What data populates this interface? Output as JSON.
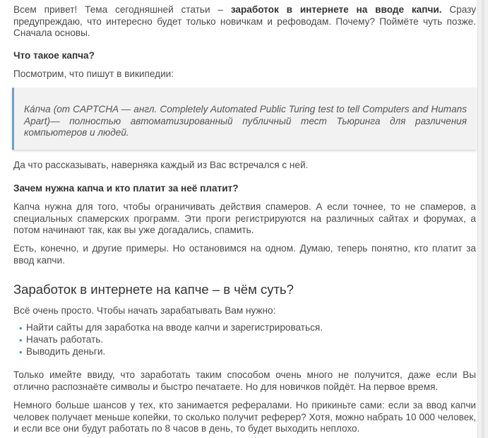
{
  "intro": {
    "text_a": "Всем привет! Тема сегодняшней статьи – ",
    "bold": "заработок в интернете на вводе капчи.",
    "text_b": " Сразу предупреждаю, что интересно будет только новичкам и рефоводам. Почему? Поймёте чуть позже. Сначала основы."
  },
  "section1": {
    "heading": "Что такое капча?",
    "lead": "Посмотрим, что пишут в википедии:",
    "quote": "Ка́пча (от CAPTCHA — англ. Completely Automated Public Turing test to tell Computers and Humans Apart)— полностью автоматизированный публичный тест Тьюринга для различения компьютеров и людей.",
    "after_quote": "Да что рассказывать, наверняка каждый из Вас встречался с ней."
  },
  "section2": {
    "heading": "Зачем нужна капча и кто платит за неё платит?",
    "p1": "Капча нужна для того, чтобы ограничивать действия спамеров. А если точнее, то не спамеров, а специальных спамерских программ. Эти проги регистрируются на различных сайтах и форумах, а потом начинают так, как вы уже догадались, спамить.",
    "p2": "Есть, конечно, и другие примеры. Но остановимся на одном. Думаю, теперь понятно, кто платит за ввод капчи."
  },
  "section3": {
    "heading": "Заработок в интернете на капче – в чём суть?",
    "lead": "Всё очень просто. Чтобы начать зарабатывать Вам нужно:",
    "items": [
      "Найти сайты для заработка на вводе капчи и зарегистрироваться.",
      "Начать работать.",
      "Выводить деньги."
    ],
    "p1": "Только имейте ввиду, что заработать таким способом очень много не получится, даже если Вы отлично распознаёте символы и быстро печатаете. Но для новичков пойдёт. На первое время.",
    "p2": "Немного больше шансов у тех, кто занимается рефералами. Но прикиньте сами: если за ввод капчи человек получает меньше копейки, то сколько получит реферер? Хотя, можно набрать 10 000 человек, и если все они будут работать по 8 часов в день, то будет выходить неплохо."
  },
  "colors": {
    "accent": "#6f9fcd",
    "bullet": "#5b8fc7",
    "quote_bg": "#f2f2f2",
    "text": "#4a4a4a"
  },
  "icons": {
    "list_bullet": "bullet-icon"
  }
}
